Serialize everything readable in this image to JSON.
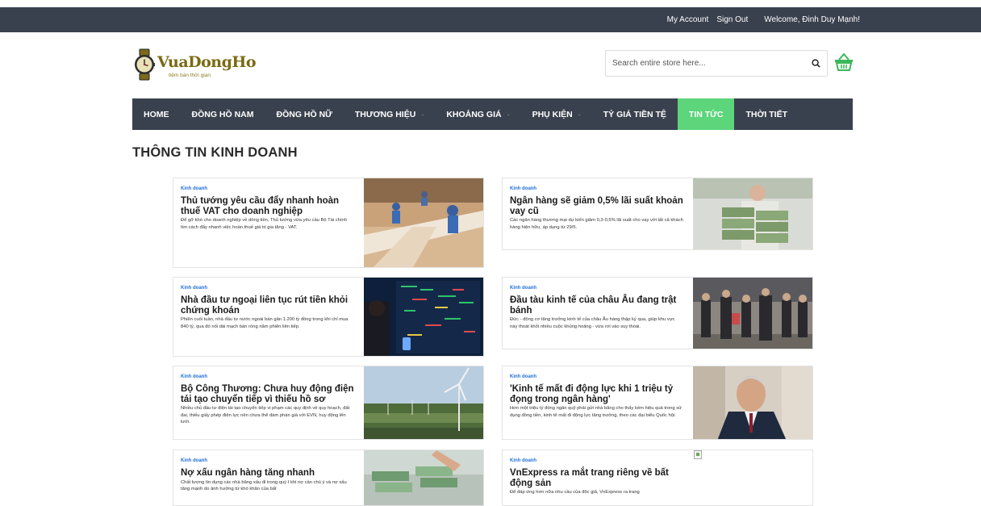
{
  "topbar": {
    "my_account": "My Account",
    "sign_out": "Sign Out",
    "welcome": "Welcome, Đinh Duy Mạnh!"
  },
  "logo": {
    "name": "VuaDongHo",
    "tagline": "tiệm bán thời gian"
  },
  "search": {
    "placeholder": "Search entire store here..."
  },
  "icons": {
    "search": "search-icon",
    "cart": "shopping-basket-icon",
    "logo": "watch-icon"
  },
  "nav": {
    "items": [
      {
        "label": "HOME",
        "has_dropdown": false,
        "active": false
      },
      {
        "label": "ĐỒNG HỒ NAM",
        "has_dropdown": false,
        "active": false
      },
      {
        "label": "ĐỒNG HỒ NỮ",
        "has_dropdown": false,
        "active": false
      },
      {
        "label": "THƯƠNG HIỆU",
        "has_dropdown": true,
        "active": false
      },
      {
        "label": "KHOẢNG GIÁ",
        "has_dropdown": true,
        "active": false
      },
      {
        "label": "PHỤ KIỆN",
        "has_dropdown": true,
        "active": false
      },
      {
        "label": "TỶ GIÁ TIỀN TỆ",
        "has_dropdown": false,
        "active": false
      },
      {
        "label": "TIN TỨC",
        "has_dropdown": false,
        "active": true
      },
      {
        "label": "THỜI TIẾT",
        "has_dropdown": false,
        "active": false
      }
    ],
    "caret": "-"
  },
  "section": {
    "title": "THÔNG TIN KINH DOANH"
  },
  "articles": [
    {
      "category": "Kinh doanh",
      "title": "Thủ tướng yêu cầu đẩy nhanh hoàn thuế VAT cho doanh nghiệp",
      "desc": "Để gỡ khó cho doanh nghiệp về dòng tiền, Thủ tướng vừa yêu cầu Bộ Tài chính tìm cách đẩy nhanh việc hoàn thuế giá trị gia tăng - VAT."
    },
    {
      "category": "Kinh doanh",
      "title": "Ngân hàng sẽ giảm 0,5% lãi suất khoản vay cũ",
      "desc": "Các ngân hàng thương mại dự kiến giảm 0,3-0,5% lãi suất cho vay với tất cả khách hàng hiện hữu, áp dụng từ 29/5."
    },
    {
      "category": "Kinh doanh",
      "title": "Nhà đầu tư ngoại liên tục rút tiền khỏi chứng khoán",
      "desc": "Phiên cuối tuần, nhà đầu tư nước ngoài bán gần 1.200 tỷ đồng trong khi chỉ mua 840 tỷ, qua đó nối dài mạch bán ròng năm phiên liên tiếp."
    },
    {
      "category": "Kinh doanh",
      "title": "Đầu tàu kinh tế của châu Âu đang trật bánh",
      "desc": "Đức - động cơ tăng trưởng kinh tế của châu Âu hàng thập kỷ qua, giúp khu vực này thoát khỏi nhiều cuộc khủng hoảng - vừa rơi vào suy thoái."
    },
    {
      "category": "Kinh doanh",
      "title": "Bộ Công Thương: Chưa huy động điện tái tạo chuyển tiếp vì thiếu hồ sơ",
      "desc": "Nhiều chủ đầu tư điện tái tạo chuyển tiếp vi phạm các quy định về quy hoạch, đất đai, thiếu giấy phép điện lực nên chưa thể đàm phán giá với EVN, huy động lên lưới."
    },
    {
      "category": "Kinh doanh",
      "title": "'Kinh tế mất đi động lực khi 1 triệu tỷ đọng trong ngân hàng'",
      "desc": "Hơn một triệu tỷ đồng ngân quỹ phải gửi nhà băng cho thấy kém hiệu quả trong sử dụng đồng tiền, kinh tế mất đi động lực tăng trưởng, theo các đại biểu Quốc hội."
    },
    {
      "category": "Kinh doanh",
      "title": "Nợ xấu ngân hàng tăng nhanh",
      "desc": "Chất lượng tín dụng các nhà băng xấu đi trong quý I khi nợ cần chú ý và nợ xấu tăng mạnh do ảnh hưởng từ khó khăn của bất"
    },
    {
      "category": "Kinh doanh",
      "title": "VnExpress ra mắt trang riêng về bất động sản",
      "desc": "Để đáp ứng hơn nữa nhu cầu của độc giả, VnExpress ra trang"
    }
  ]
}
